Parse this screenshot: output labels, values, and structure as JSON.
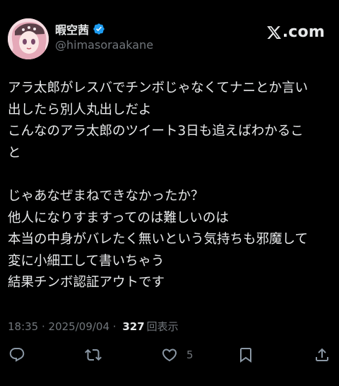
{
  "header": {
    "display_name": "暇空茜",
    "handle": "@himasoraakane",
    "brand": ".com"
  },
  "tweet": {
    "lines": [
      "アラ太郎がレスバでチンボじゃなくてナニとか言い",
      "出したら別人丸出しだよ",
      "こんなのアラ太郎のツイート3日も追えばわかるこ",
      "と",
      "",
      "じゃあなぜまねできなかったか？",
      "他人になりすますってのは難しいのは",
      "本当の中身がバレたく無いという気持ちも邪魔して",
      "変に小細工して書いちゃう",
      "結果チンボ認証アウトです"
    ]
  },
  "meta": {
    "time": "18:35",
    "separator1": " · ",
    "date": "2025/09/04",
    "separator2": " · ",
    "views_count": "327",
    "views_label": "回表示"
  },
  "actions": {
    "like_count": "5"
  },
  "colors": {
    "background": "#000000",
    "text": "#e7e9ea",
    "secondary": "#71767b",
    "verified": "#1d9bf0"
  }
}
